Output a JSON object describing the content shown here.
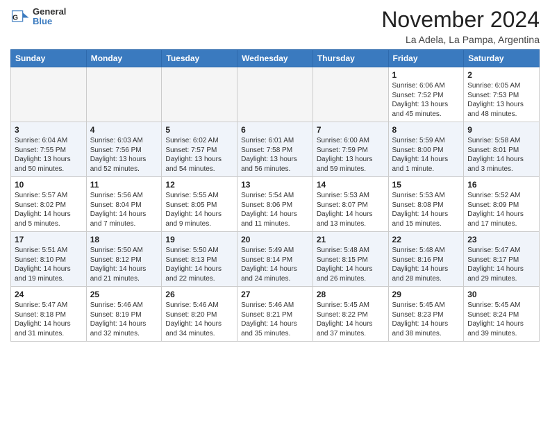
{
  "header": {
    "logo_line1": "General",
    "logo_line2": "Blue",
    "month": "November 2024",
    "location": "La Adela, La Pampa, Argentina"
  },
  "columns": [
    "Sunday",
    "Monday",
    "Tuesday",
    "Wednesday",
    "Thursday",
    "Friday",
    "Saturday"
  ],
  "weeks": [
    {
      "days": [
        {
          "num": "",
          "info": ""
        },
        {
          "num": "",
          "info": ""
        },
        {
          "num": "",
          "info": ""
        },
        {
          "num": "",
          "info": ""
        },
        {
          "num": "",
          "info": ""
        },
        {
          "num": "1",
          "info": "Sunrise: 6:06 AM\nSunset: 7:52 PM\nDaylight: 13 hours\nand 45 minutes."
        },
        {
          "num": "2",
          "info": "Sunrise: 6:05 AM\nSunset: 7:53 PM\nDaylight: 13 hours\nand 48 minutes."
        }
      ]
    },
    {
      "days": [
        {
          "num": "3",
          "info": "Sunrise: 6:04 AM\nSunset: 7:55 PM\nDaylight: 13 hours\nand 50 minutes."
        },
        {
          "num": "4",
          "info": "Sunrise: 6:03 AM\nSunset: 7:56 PM\nDaylight: 13 hours\nand 52 minutes."
        },
        {
          "num": "5",
          "info": "Sunrise: 6:02 AM\nSunset: 7:57 PM\nDaylight: 13 hours\nand 54 minutes."
        },
        {
          "num": "6",
          "info": "Sunrise: 6:01 AM\nSunset: 7:58 PM\nDaylight: 13 hours\nand 56 minutes."
        },
        {
          "num": "7",
          "info": "Sunrise: 6:00 AM\nSunset: 7:59 PM\nDaylight: 13 hours\nand 59 minutes."
        },
        {
          "num": "8",
          "info": "Sunrise: 5:59 AM\nSunset: 8:00 PM\nDaylight: 14 hours\nand 1 minute."
        },
        {
          "num": "9",
          "info": "Sunrise: 5:58 AM\nSunset: 8:01 PM\nDaylight: 14 hours\nand 3 minutes."
        }
      ]
    },
    {
      "days": [
        {
          "num": "10",
          "info": "Sunrise: 5:57 AM\nSunset: 8:02 PM\nDaylight: 14 hours\nand 5 minutes."
        },
        {
          "num": "11",
          "info": "Sunrise: 5:56 AM\nSunset: 8:04 PM\nDaylight: 14 hours\nand 7 minutes."
        },
        {
          "num": "12",
          "info": "Sunrise: 5:55 AM\nSunset: 8:05 PM\nDaylight: 14 hours\nand 9 minutes."
        },
        {
          "num": "13",
          "info": "Sunrise: 5:54 AM\nSunset: 8:06 PM\nDaylight: 14 hours\nand 11 minutes."
        },
        {
          "num": "14",
          "info": "Sunrise: 5:53 AM\nSunset: 8:07 PM\nDaylight: 14 hours\nand 13 minutes."
        },
        {
          "num": "15",
          "info": "Sunrise: 5:53 AM\nSunset: 8:08 PM\nDaylight: 14 hours\nand 15 minutes."
        },
        {
          "num": "16",
          "info": "Sunrise: 5:52 AM\nSunset: 8:09 PM\nDaylight: 14 hours\nand 17 minutes."
        }
      ]
    },
    {
      "days": [
        {
          "num": "17",
          "info": "Sunrise: 5:51 AM\nSunset: 8:10 PM\nDaylight: 14 hours\nand 19 minutes."
        },
        {
          "num": "18",
          "info": "Sunrise: 5:50 AM\nSunset: 8:12 PM\nDaylight: 14 hours\nand 21 minutes."
        },
        {
          "num": "19",
          "info": "Sunrise: 5:50 AM\nSunset: 8:13 PM\nDaylight: 14 hours\nand 22 minutes."
        },
        {
          "num": "20",
          "info": "Sunrise: 5:49 AM\nSunset: 8:14 PM\nDaylight: 14 hours\nand 24 minutes."
        },
        {
          "num": "21",
          "info": "Sunrise: 5:48 AM\nSunset: 8:15 PM\nDaylight: 14 hours\nand 26 minutes."
        },
        {
          "num": "22",
          "info": "Sunrise: 5:48 AM\nSunset: 8:16 PM\nDaylight: 14 hours\nand 28 minutes."
        },
        {
          "num": "23",
          "info": "Sunrise: 5:47 AM\nSunset: 8:17 PM\nDaylight: 14 hours\nand 29 minutes."
        }
      ]
    },
    {
      "days": [
        {
          "num": "24",
          "info": "Sunrise: 5:47 AM\nSunset: 8:18 PM\nDaylight: 14 hours\nand 31 minutes."
        },
        {
          "num": "25",
          "info": "Sunrise: 5:46 AM\nSunset: 8:19 PM\nDaylight: 14 hours\nand 32 minutes."
        },
        {
          "num": "26",
          "info": "Sunrise: 5:46 AM\nSunset: 8:20 PM\nDaylight: 14 hours\nand 34 minutes."
        },
        {
          "num": "27",
          "info": "Sunrise: 5:46 AM\nSunset: 8:21 PM\nDaylight: 14 hours\nand 35 minutes."
        },
        {
          "num": "28",
          "info": "Sunrise: 5:45 AM\nSunset: 8:22 PM\nDaylight: 14 hours\nand 37 minutes."
        },
        {
          "num": "29",
          "info": "Sunrise: 5:45 AM\nSunset: 8:23 PM\nDaylight: 14 hours\nand 38 minutes."
        },
        {
          "num": "30",
          "info": "Sunrise: 5:45 AM\nSunset: 8:24 PM\nDaylight: 14 hours\nand 39 minutes."
        }
      ]
    }
  ]
}
